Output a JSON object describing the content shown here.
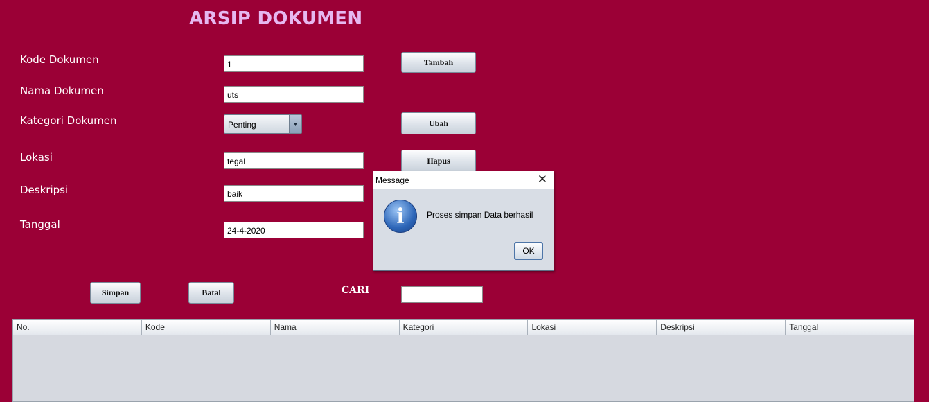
{
  "title": "ARSIP DOKUMEN",
  "form": {
    "kode_label": "Kode Dokumen",
    "kode_value": "1",
    "nama_label": "Nama Dokumen",
    "nama_value": "uts",
    "kategori_label": "Kategori Dokumen",
    "kategori_value": "Penting",
    "lokasi_label": "Lokasi",
    "lokasi_value": "tegal",
    "deskripsi_label": "Deskripsi",
    "deskripsi_value": "baik",
    "tanggal_label": "Tanggal",
    "tanggal_value": "24-4-2020"
  },
  "buttons": {
    "tambah": "Tambah",
    "ubah": "Ubah",
    "hapus": "Hapus",
    "simpan": "Simpan",
    "batal": "Batal"
  },
  "search": {
    "label": "CARI",
    "value": ""
  },
  "table": {
    "columns": [
      "No.",
      "Kode",
      "Nama",
      "Kategori",
      "Lokasi",
      "Deskripsi",
      "Tanggal"
    ]
  },
  "dialog": {
    "title": "Message",
    "message": "Proses simpan Data berhasil",
    "ok_label": "OK",
    "icon": "info-icon"
  },
  "colors": {
    "background": "#9b0036",
    "title": "#e6b8f0"
  }
}
